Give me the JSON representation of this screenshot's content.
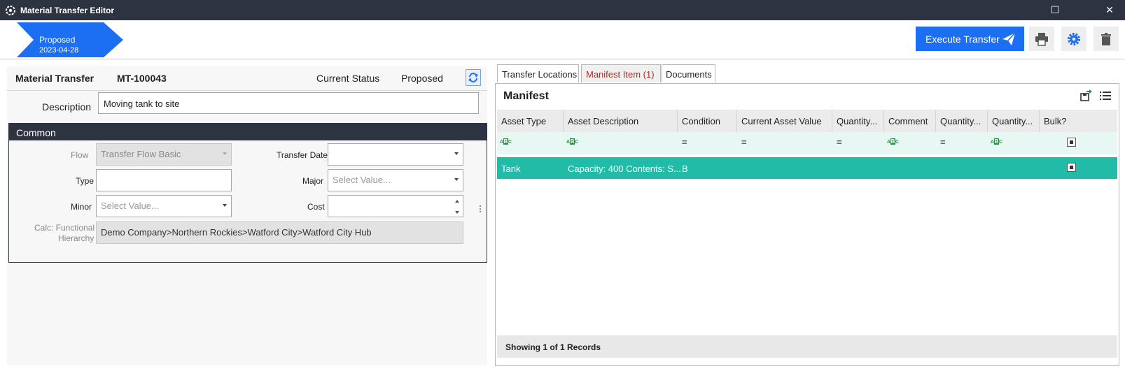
{
  "window": {
    "title": "Material Transfer Editor",
    "maximize_icon": "☐",
    "close_icon": "✕"
  },
  "toolbar": {
    "status_label": "Proposed",
    "status_date": "2023-04-28",
    "execute_label": "Execute Transfer",
    "colors": {
      "accent": "#1c6ef2",
      "status": "#1c6ef2"
    }
  },
  "record": {
    "type_label": "Material Transfer",
    "id": "MT-100043",
    "status_label": "Current Status",
    "status_value": "Proposed",
    "description_label": "Description",
    "description_value": "Moving tank to site"
  },
  "common": {
    "title": "Common",
    "flow_label": "Flow",
    "flow_value": "Transfer Flow Basic",
    "transfer_date_label": "Transfer Date",
    "transfer_date_value": "",
    "type_label": "Type",
    "type_value": "",
    "major_label": "Major",
    "major_placeholder": "Select Value...",
    "minor_label": "Minor",
    "minor_placeholder": "Select Value...",
    "cost_label": "Cost",
    "cost_value": "",
    "hierarchy_label_1": "Calc: Functional",
    "hierarchy_label_2": "Hierarchy",
    "hierarchy_value": "Demo Company>Northern Rockies>Watford City>Watford City Hub"
  },
  "tabs": [
    {
      "label": "Transfer Locations"
    },
    {
      "label": "Manifest Item (1)"
    },
    {
      "label": "Documents"
    }
  ],
  "manifest": {
    "title": "Manifest",
    "columns": [
      "Asset Type",
      "Asset Description",
      "Condition",
      "Current Asset Value",
      "Quantity...",
      "Comment",
      "Quantity...",
      "Quantity...",
      "Bulk?"
    ],
    "filter_abc": "ABC",
    "filter_eq": "=",
    "rows": [
      {
        "asset_type": "Tank",
        "asset_description": "Capacity: 400 Contents: S...",
        "condition": "B"
      }
    ],
    "footer": "Showing 1 of 1 Records",
    "row_color": "#21bba7"
  }
}
